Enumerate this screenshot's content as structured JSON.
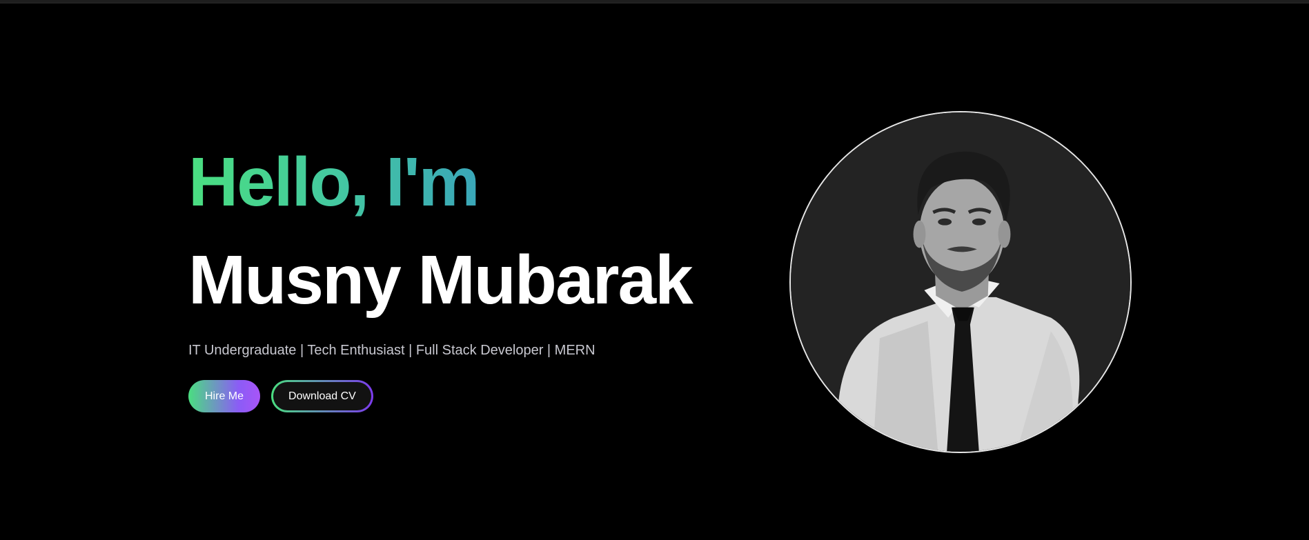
{
  "hero": {
    "greeting": "Hello, I'm",
    "name": "Musny Mubarak",
    "tagline": "IT Undergraduate | Tech Enthusiast | Full Stack Developer | MERN",
    "hire_label": "Hire Me",
    "cv_label": "Download CV"
  },
  "colors": {
    "background": "#000000",
    "accent_green": "#4ade80",
    "accent_teal": "#3aa6b9",
    "accent_purple": "#8b5cf6",
    "name_text": "#ffffff",
    "tagline_text": "#c8c8d0"
  },
  "portrait": {
    "icon": "person-portrait-icon"
  }
}
